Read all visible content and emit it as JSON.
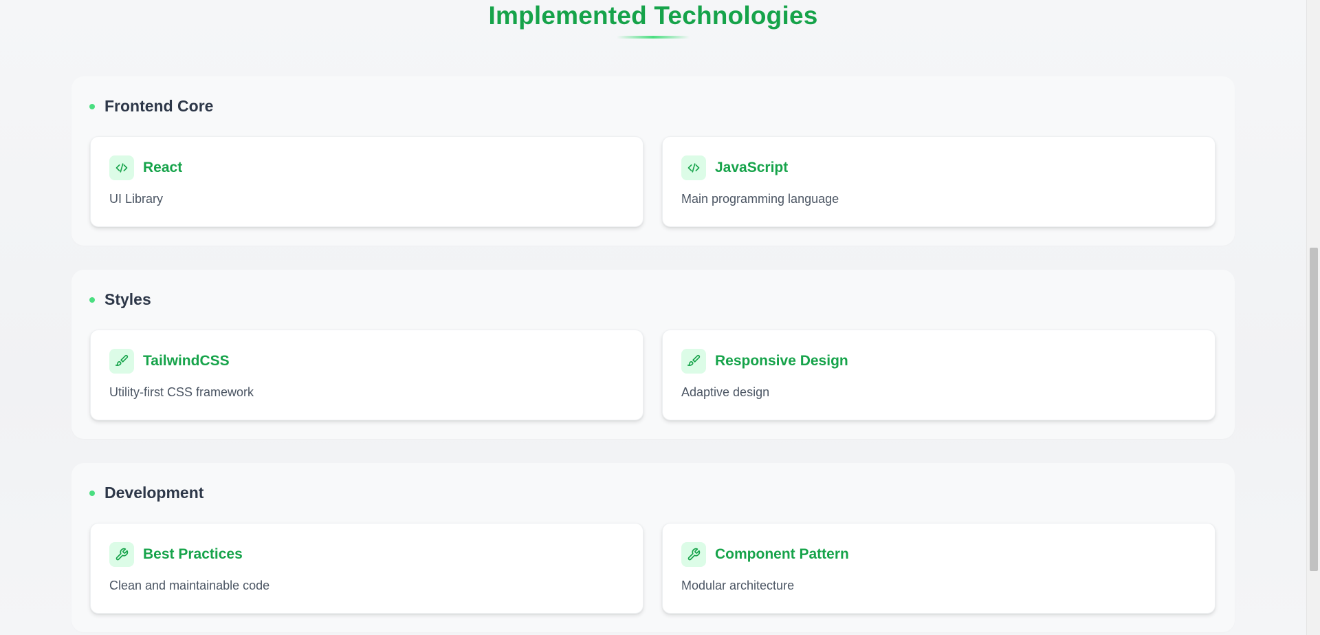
{
  "page": {
    "title": "Implemented Technologies"
  },
  "colors": {
    "accent": "#16a34a",
    "accent_light": "#dcfce7",
    "dot": "#4ade80",
    "heading": "#2d3748",
    "text": "#4b5563"
  },
  "sections": [
    {
      "title": "Frontend Core",
      "cards": [
        {
          "icon": "code-icon",
          "title": "React",
          "description": "UI Library"
        },
        {
          "icon": "code-icon",
          "title": "JavaScript",
          "description": "Main programming language"
        }
      ]
    },
    {
      "title": "Styles",
      "cards": [
        {
          "icon": "paintbrush-icon",
          "title": "TailwindCSS",
          "description": "Utility-first CSS framework"
        },
        {
          "icon": "paintbrush-icon",
          "title": "Responsive Design",
          "description": "Adaptive design"
        }
      ]
    },
    {
      "title": "Development",
      "cards": [
        {
          "icon": "wrench-icon",
          "title": "Best Practices",
          "description": "Clean and maintainable code"
        },
        {
          "icon": "wrench-icon",
          "title": "Component Pattern",
          "description": "Modular architecture"
        }
      ]
    }
  ]
}
